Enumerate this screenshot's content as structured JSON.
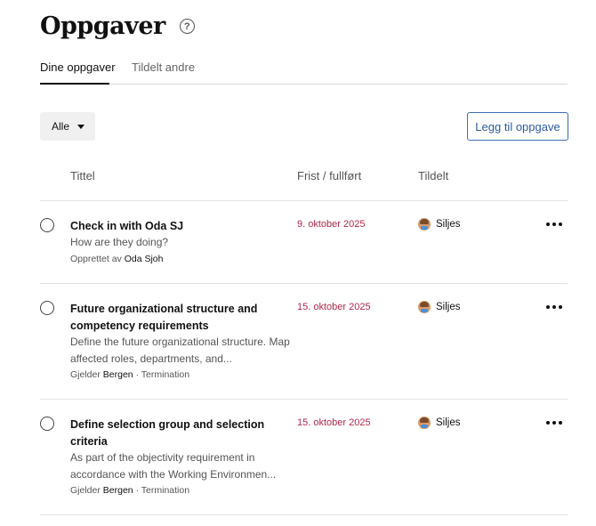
{
  "header": {
    "title": "Oppgaver",
    "help_symbol": "?"
  },
  "tabs": [
    {
      "label": "Dine oppgaver",
      "active": true
    },
    {
      "label": "Tildelt andre",
      "active": false
    }
  ],
  "filter": {
    "selected": "Alle"
  },
  "add_button": {
    "label": "Legg til oppgave"
  },
  "columns": {
    "title": "Tittel",
    "due": "Frist / fullført",
    "assigned": "Tildelt"
  },
  "tasks": [
    {
      "title": "Check in with Oda SJ",
      "description": "How are they doing?",
      "meta_prefix": "Opprettet av",
      "meta_strong": "Oda Sjoh",
      "meta_suffix": "",
      "due": "9. oktober 2025",
      "assignee": "Siljes"
    },
    {
      "title": "Future organizational structure and competency requirements",
      "description": "Define the future organizational structure. Map affected roles, departments, and...",
      "meta_prefix": "Gjelder",
      "meta_strong": "Bergen",
      "meta_suffix": "· Termination",
      "due": "15. oktober 2025",
      "assignee": "Siljes"
    },
    {
      "title": "Define selection group and selection criteria",
      "description": "As part of the objectivity requirement in accordance with the Working Environmen...",
      "meta_prefix": "Gjelder",
      "meta_strong": "Bergen",
      "meta_suffix": "· Termination",
      "due": "15. oktober 2025",
      "assignee": "Siljes"
    }
  ],
  "colors": {
    "due_text": "#b0294b",
    "primary_button": "#2c5aa0",
    "tab_underline": "#111111"
  }
}
